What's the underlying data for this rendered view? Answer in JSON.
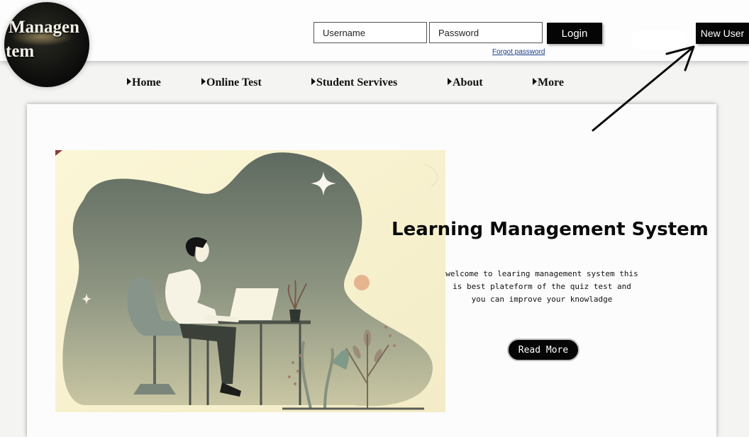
{
  "logo": {
    "line1": "Managen",
    "line2": "tem"
  },
  "login": {
    "username_placeholder": "Username",
    "password_placeholder": "Password",
    "login_label": "Login",
    "forgot_label": "Forgot password",
    "new_user_label": "New User"
  },
  "nav": {
    "items": [
      {
        "label": "Home"
      },
      {
        "label": "Online Test"
      },
      {
        "label": "Student Servives"
      },
      {
        "label": "About"
      },
      {
        "label": "More"
      }
    ]
  },
  "hero": {
    "title": "Learning Management System",
    "text_lines": [
      "welcome to learing management system this",
      "is best plateform of the quiz test and",
      "you can improve your knowladge"
    ],
    "button_label": "Read More"
  },
  "colors": {
    "button_bg": "#050505",
    "accent_blob": "#7d8a7a",
    "warm_bg": "#f7f0cf"
  }
}
